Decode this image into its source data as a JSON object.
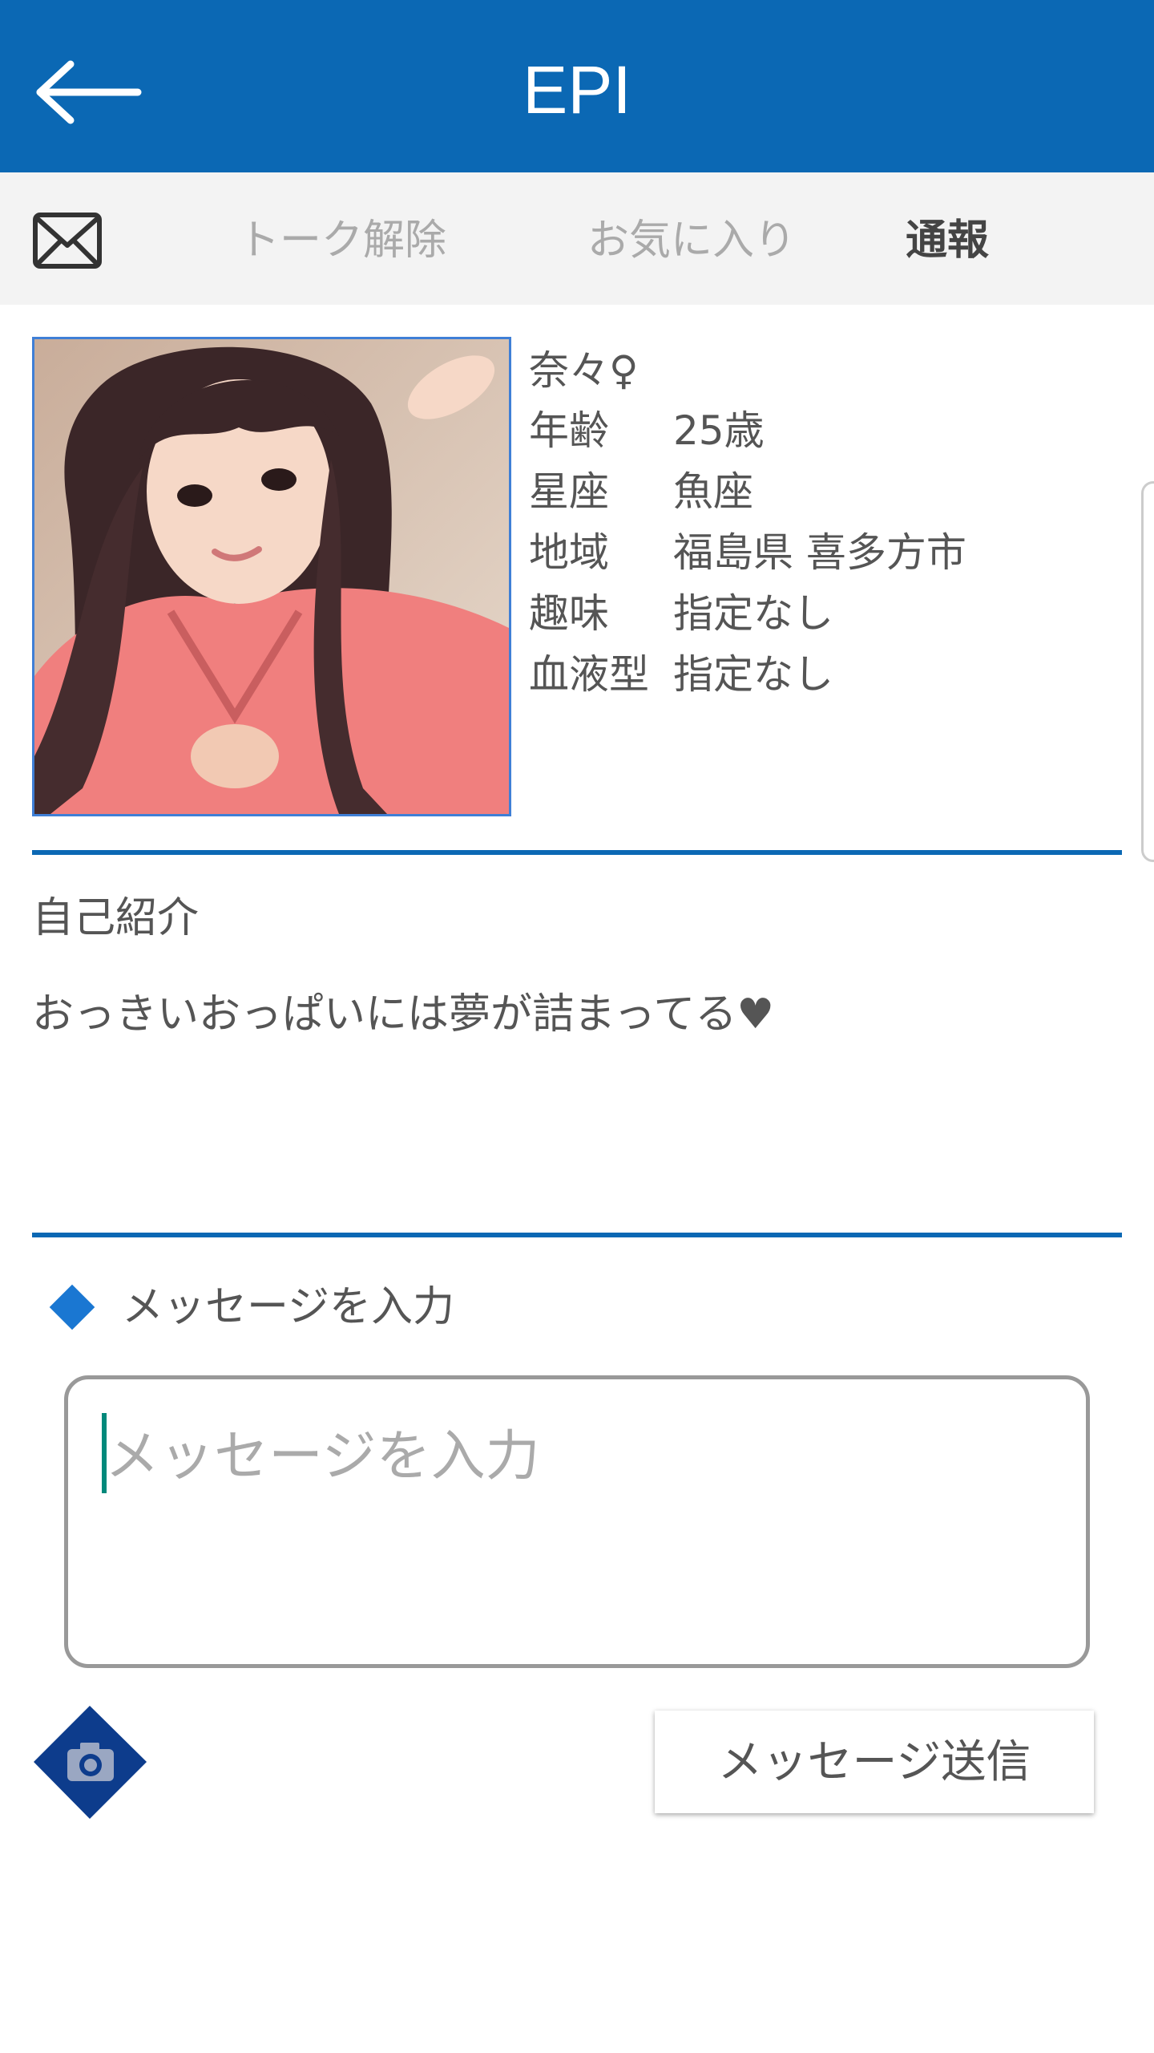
{
  "header": {
    "title": "EPI",
    "back_icon": "arrow-left-icon",
    "background_color": "#0b68b4"
  },
  "action_bar": {
    "mail_icon": "mail-icon",
    "talk_release": "トーク解除",
    "favorite": "お気に入り",
    "report": "通報"
  },
  "profile": {
    "name": "奈々♀",
    "rows": [
      {
        "label": "年齢",
        "value": "25歳"
      },
      {
        "label": "星座",
        "value": "魚座"
      },
      {
        "label": "地域",
        "value": "福島県 喜多方市"
      },
      {
        "label": "趣味",
        "value": "指定なし"
      },
      {
        "label": "血液型",
        "value": "指定なし"
      }
    ]
  },
  "intro": {
    "heading": "自己紹介",
    "text": "おっきいおっぱいには夢が詰まってる♥"
  },
  "message": {
    "heading": "メッセージを入力",
    "placeholder": "メッセージを入力",
    "value": "",
    "send_label": "メッセージ送信",
    "camera_icon": "camera-icon",
    "accent_color": "#1a77d2"
  }
}
